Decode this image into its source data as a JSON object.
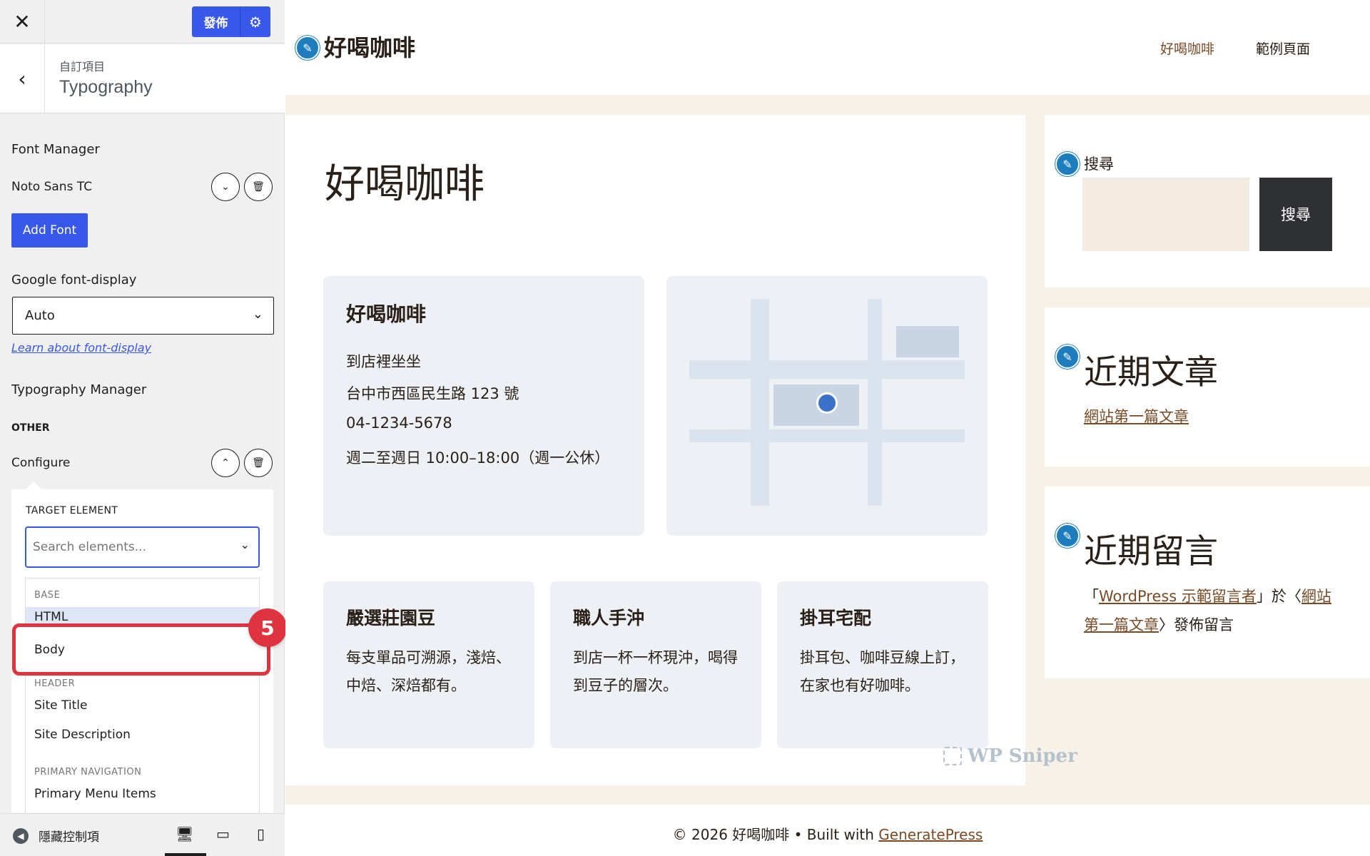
{
  "customizer": {
    "close_icon": "close-icon",
    "publish_label": "發佈",
    "settings_icon": "gear-icon",
    "breadcrumb": "自訂項目",
    "section_title": "Typography",
    "font_manager": {
      "heading": "Font Manager",
      "font_name": "Noto Sans TC",
      "add_font_label": "Add Font"
    },
    "font_display": {
      "heading": "Google font-display",
      "selected": "Auto",
      "learn_link": "Learn about font-display"
    },
    "typography_manager": {
      "heading": "Typography Manager",
      "group": "OTHER",
      "item_label": "Configure",
      "target_element_label": "TARGET ELEMENT",
      "search_placeholder": "Search elements...",
      "options": {
        "base_group": "BASE",
        "html": "HTML",
        "body": "Body",
        "header_group": "HEADER",
        "site_title": "Site Title",
        "site_description": "Site Description",
        "primary_nav_group": "PRIMARY NAVIGATION",
        "primary_menu_items": "Primary Menu Items"
      }
    },
    "step_badge": "5",
    "hide_controls_label": "隱藏控制項",
    "devices": [
      "desktop",
      "tablet",
      "mobile"
    ]
  },
  "preview": {
    "site_title": "好喝咖啡",
    "nav": [
      "好喝咖啡",
      "範例頁面"
    ],
    "page_title": "好喝咖啡",
    "info_card": {
      "title": "好喝咖啡",
      "lines": [
        "到店裡坐坐",
        "台中市西區民生路 123 號",
        "04-1234-5678",
        "週二至週日 10:00–18:00（週一公休）"
      ]
    },
    "features": [
      {
        "title": "嚴選莊園豆",
        "desc": "每支單品可溯源，淺焙、中焙、深焙都有。"
      },
      {
        "title": "職人手沖",
        "desc": "到店一杯一杯現沖，喝得到豆子的層次。"
      },
      {
        "title": "掛耳宅配",
        "desc": "掛耳包、咖啡豆線上訂，在家也有好咖啡。"
      }
    ],
    "widgets": {
      "search_label": "搜尋",
      "search_button": "搜尋",
      "recent_posts_title": "近期文章",
      "recent_post": "網站第一篇文章",
      "recent_comments_title": "近期留言",
      "comment_open": "「",
      "comment_author": "WordPress 示範留言者",
      "comment_mid": "」於〈",
      "comment_post": "網站第一篇文章",
      "comment_end": "〉發佈留言"
    },
    "watermark": "WP Sniper",
    "footer_prefix": "© 2026 好喝咖啡 • Built with ",
    "footer_link": "GeneratePress"
  },
  "colors": {
    "accent": "#3858e9",
    "highlight": "#e03340",
    "edit_pencil": "#1d7dbd",
    "site_text": "#2b2018",
    "link": "#7a4a26",
    "site_background": "#f8f1e8"
  }
}
